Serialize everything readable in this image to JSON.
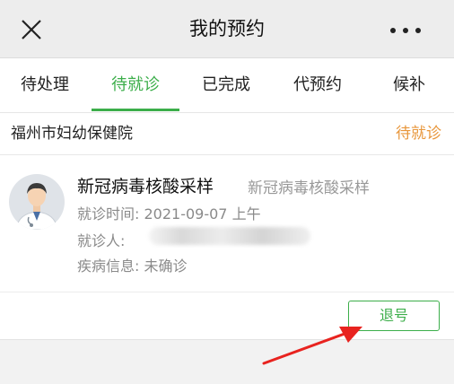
{
  "header": {
    "title": "我的预约",
    "close_icon": "close-icon",
    "more_icon": "more-icon"
  },
  "tabs": [
    {
      "label": "待处理",
      "active": false
    },
    {
      "label": "待就诊",
      "active": true
    },
    {
      "label": "已完成",
      "active": false
    },
    {
      "label": "代预约",
      "active": false
    },
    {
      "label": "候补",
      "active": false
    }
  ],
  "hospital": {
    "name": "福州市妇幼保健院",
    "status": "待就诊"
  },
  "appointment": {
    "service": "新冠病毒核酸采样",
    "department": "新冠病毒核酸采样",
    "time_label": "就诊时间:",
    "time_value": "2021-09-07 上午",
    "patient_label": "就诊人:",
    "disease_label": "疾病信息:",
    "disease_value": "未确诊",
    "cancel_label": "退号"
  },
  "colors": {
    "accent": "#3cae4a",
    "status": "#e8963a",
    "annotation_arrow": "#e8231f"
  }
}
